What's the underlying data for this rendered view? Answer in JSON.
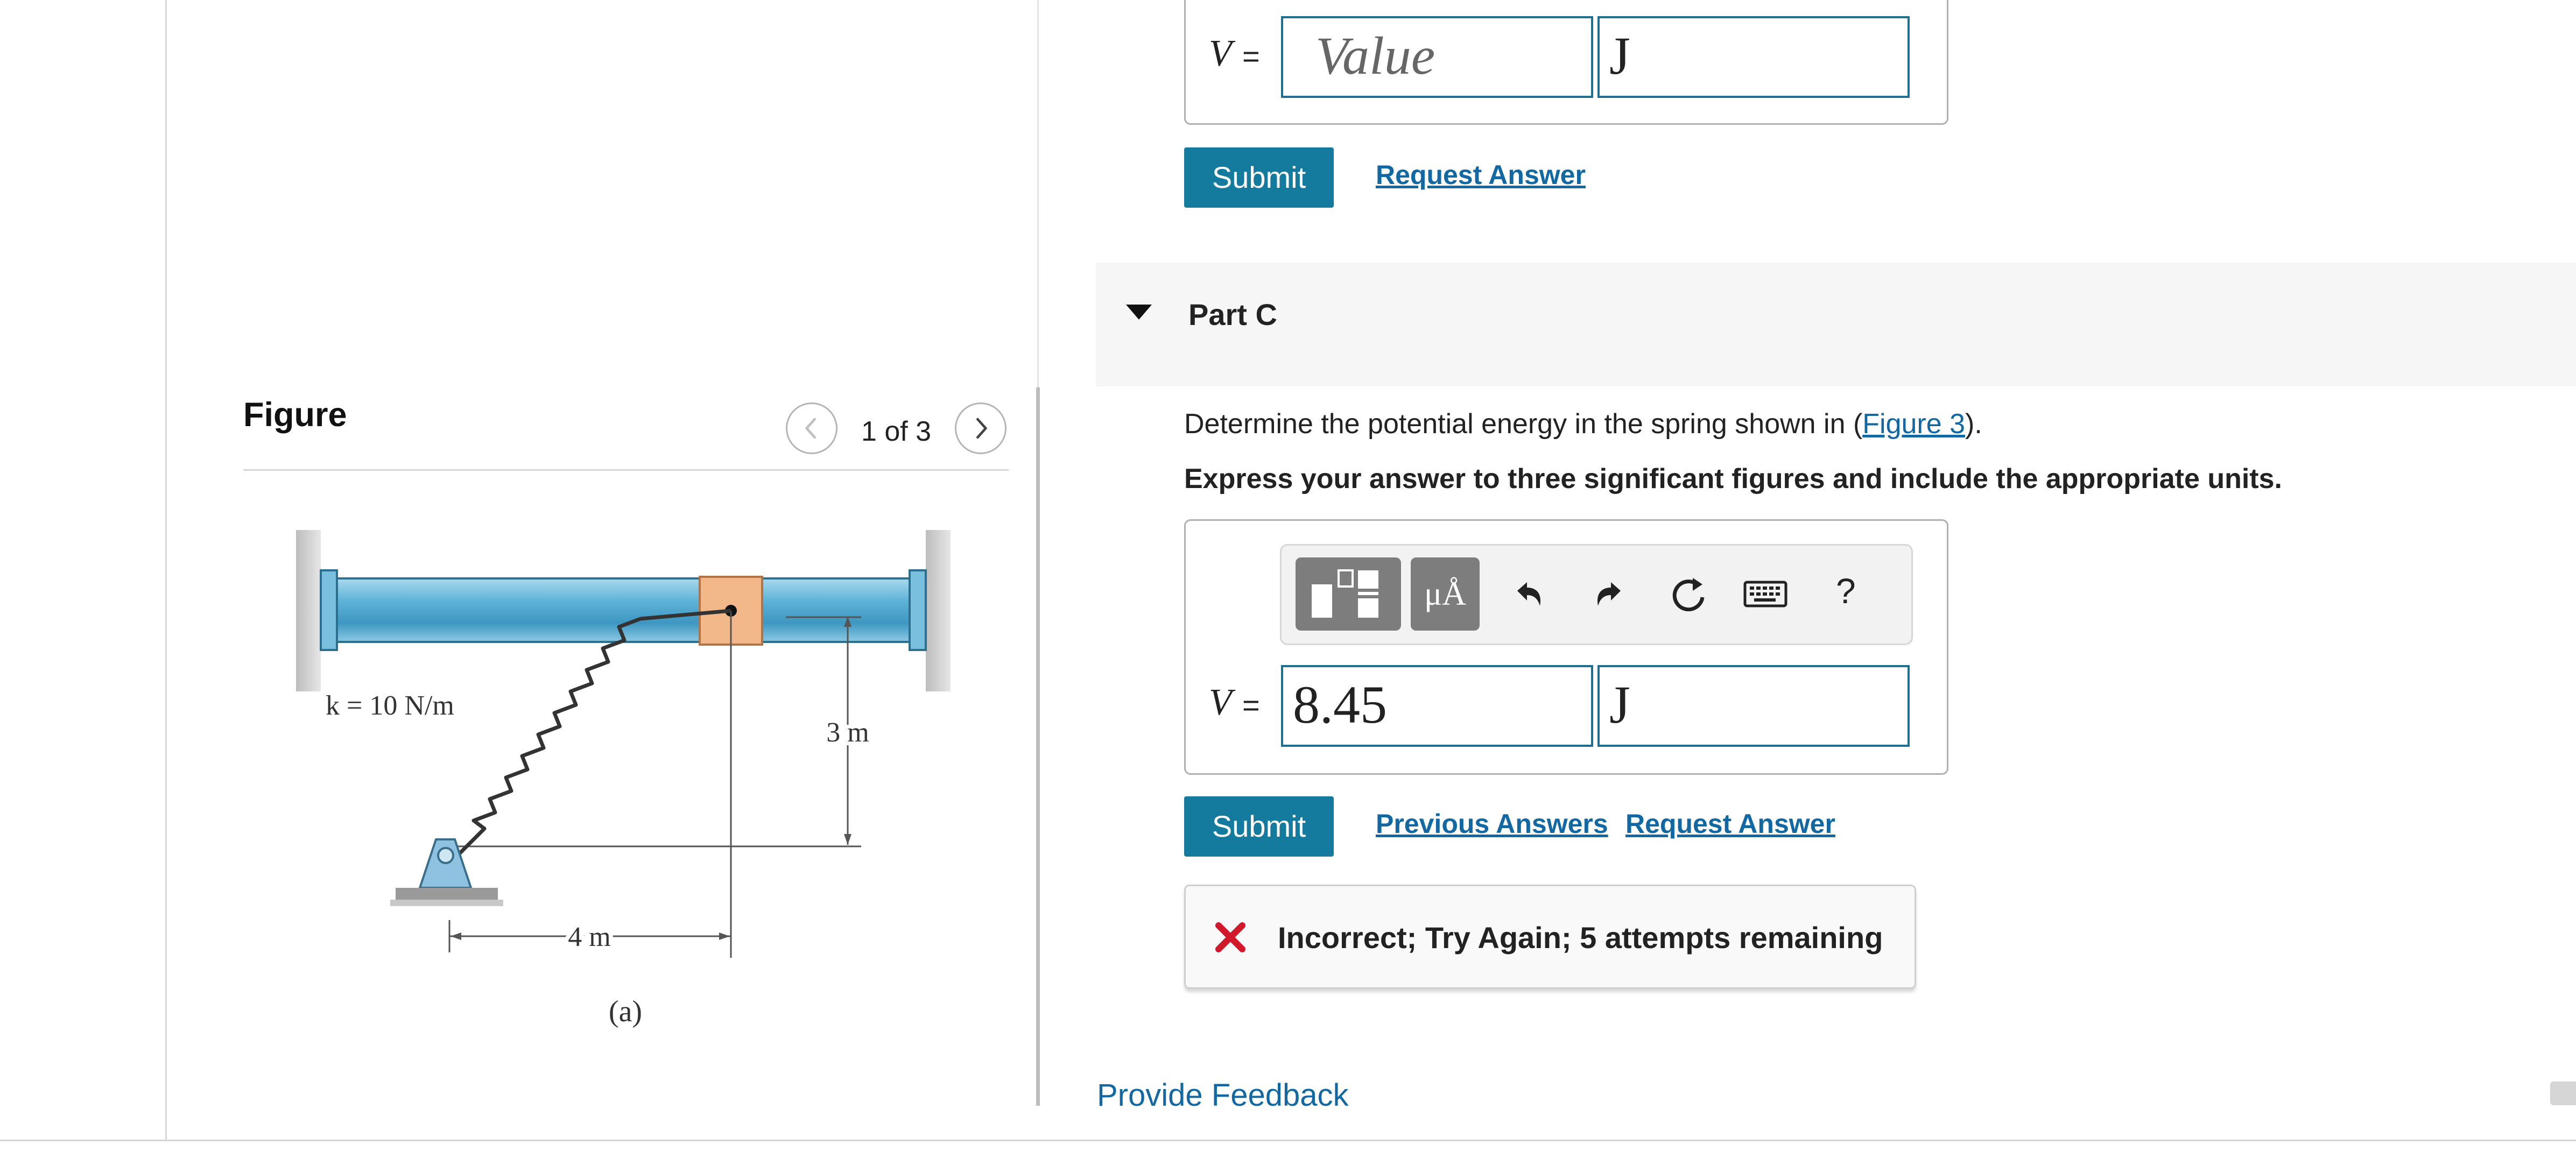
{
  "figure_panel": {
    "title": "Figure",
    "counter": "1 of 3",
    "prev_icon": "chevron-left-icon",
    "next_icon": "chevron-right-icon",
    "diagram": {
      "spring_label": "k = 10 N/m",
      "vertical_dimension": "3 m",
      "horizontal_dimension": "4 m",
      "caption": "(a)"
    }
  },
  "part_b": {
    "variable": "V",
    "equals": "=",
    "value_placeholder": "Value",
    "units_value": "J",
    "submit_label": "Submit",
    "request_answer_label": "Request Answer"
  },
  "part_c": {
    "toggle_icon": "caret-down-icon",
    "title": "Part C",
    "question_prefix": "Determine the potential energy in the spring shown in (",
    "question_link": "Figure 3",
    "question_suffix": ").",
    "instruction": "Express your answer to three significant figures and include the appropriate units.",
    "toolbar": {
      "templates_icon": "templates-icon",
      "symbols_label": "μÅ",
      "undo_icon": "undo-icon",
      "redo_icon": "redo-icon",
      "reset_icon": "reset-icon",
      "keyboard_icon": "keyboard-icon",
      "help_label": "?"
    },
    "variable": "V",
    "equals": "=",
    "value": "8.45",
    "units_value": "J",
    "submit_label": "Submit",
    "previous_answers_label": "Previous Answers",
    "request_answer_label": "Request Answer",
    "feedback": {
      "icon": "x-mark-icon",
      "text": "Incorrect; Try Again; 5 attempts remaining",
      "color": "#d0192a"
    }
  },
  "footer": {
    "provide_feedback_label": "Provide Feedback"
  },
  "colors": {
    "accent": "#147a9e",
    "link": "#1268a2",
    "field_border": "#1f6f91",
    "beam": "#5fb3d8",
    "collar": "#f2b88a"
  }
}
